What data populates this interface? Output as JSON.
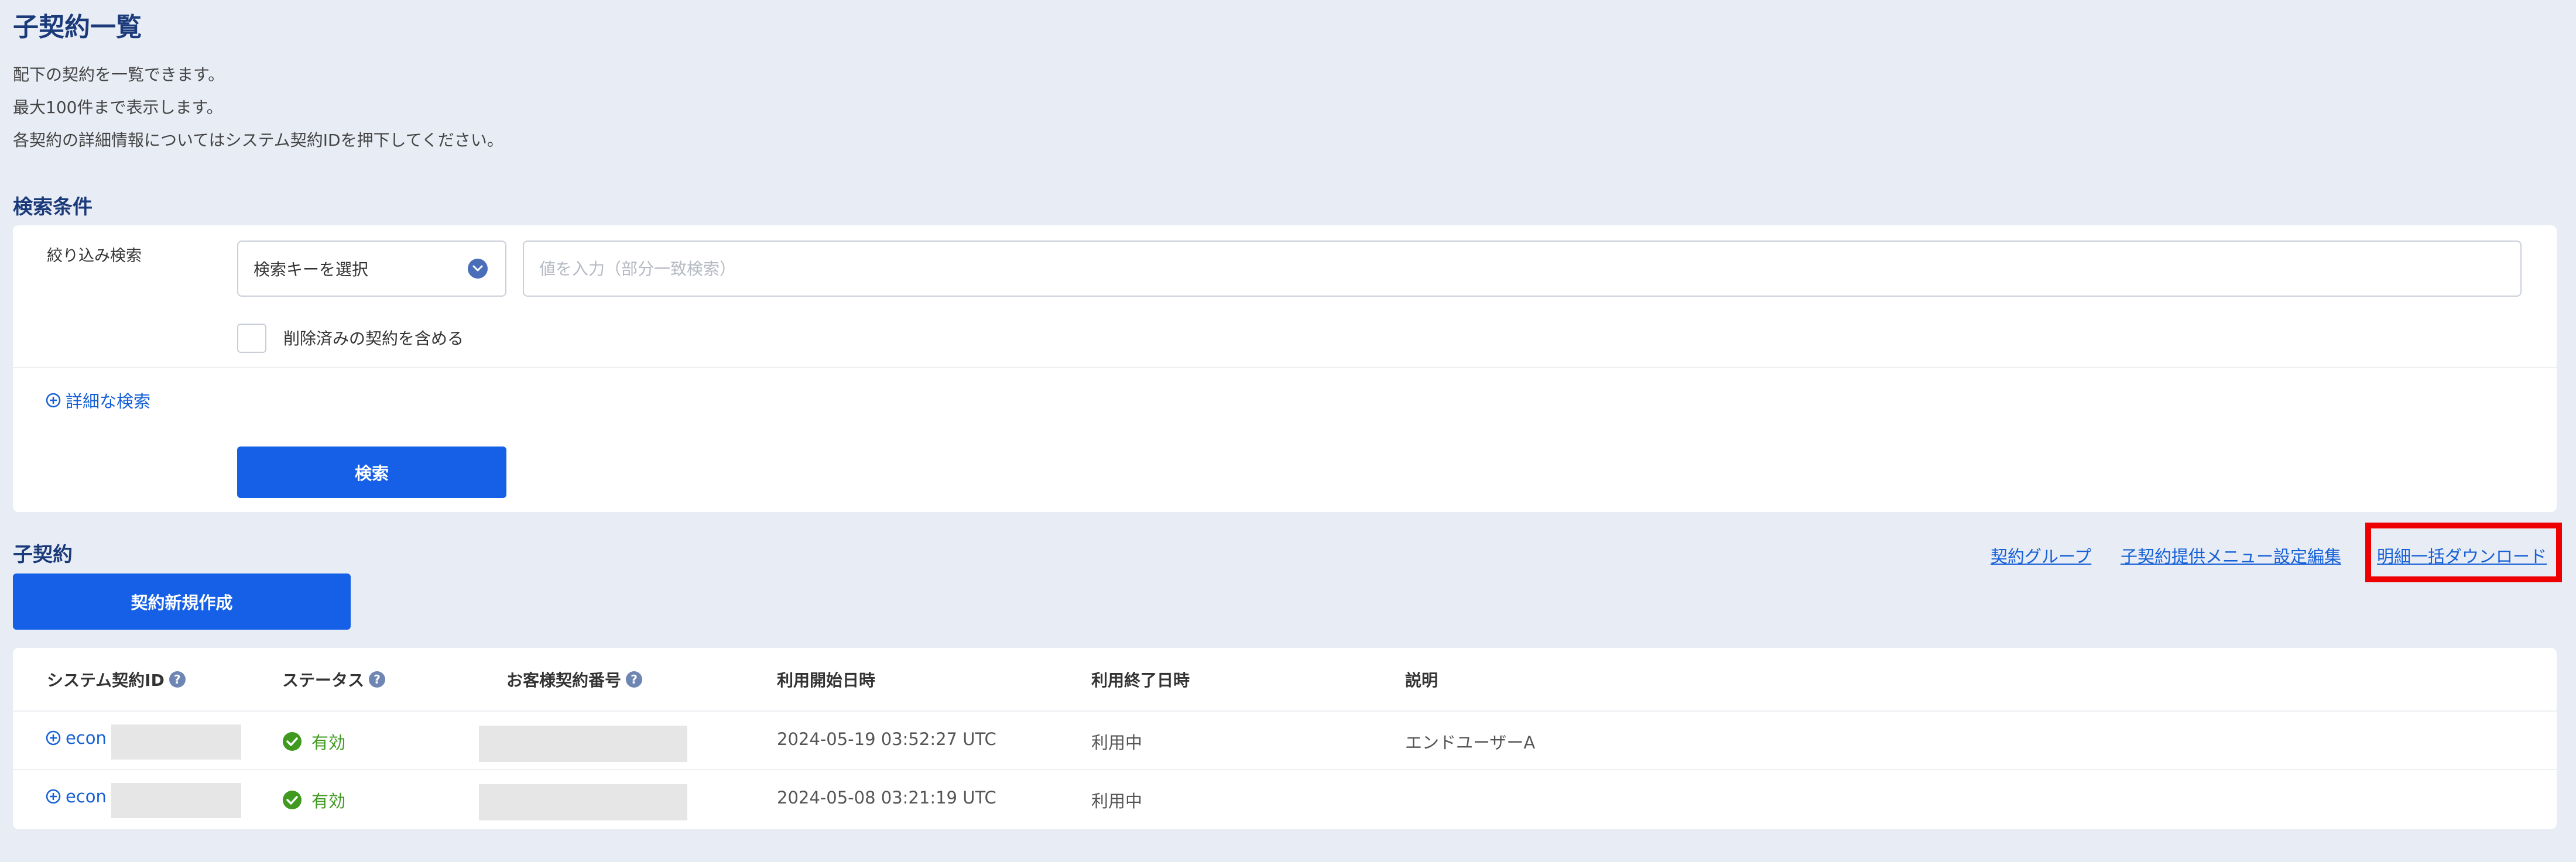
{
  "page": {
    "title": "子契約一覧",
    "description": [
      "配下の契約を一覧できます。",
      "最大100件まで表示します。",
      "各契約の詳細情報についてはシステム契約IDを押下してください。"
    ]
  },
  "search": {
    "section_title": "検索条件",
    "filter_label": "絞り込み検索",
    "key_select_value": "検索キーを選択",
    "value_placeholder": "値を入力（部分一致検索）",
    "include_deleted_label": "削除済みの契約を含める",
    "advanced_search_label": "詳細な検索",
    "submit_label": "検索"
  },
  "contracts": {
    "section_title": "子契約",
    "new_button_label": "契約新規作成",
    "links": {
      "contract_group": "契約グループ",
      "menu_settings": "子契約提供メニュー設定編集",
      "bulk_download": "明細一括ダウンロード"
    },
    "columns": {
      "system_id": "システム契約ID",
      "status": "ステータス",
      "customer_no": "お客様契約番号",
      "start": "利用開始日時",
      "end": "利用終了日時",
      "description": "説明"
    },
    "rows": [
      {
        "id_prefix": "econ",
        "status": "有効",
        "start": "2024-05-19 03:52:27 UTC",
        "end": "利用中",
        "description": "エンドユーザーA"
      },
      {
        "id_prefix": "econ",
        "status": "有効",
        "start": "2024-05-08 03:21:19 UTC",
        "end": "利用中",
        "description": ""
      }
    ]
  },
  "colors": {
    "background": "#e8ecf5",
    "primary": "#1560e6",
    "link": "#1560d6",
    "title": "#1a3a7a",
    "success": "#3f9a1f",
    "highlight": "#ee0000"
  },
  "icons": {
    "select_chevron": "chevron-down-icon",
    "advanced_search": "plus-circle-icon",
    "help": "question-icon",
    "status_ok": "check-circle-icon",
    "row_expand": "plus-circle-icon"
  }
}
